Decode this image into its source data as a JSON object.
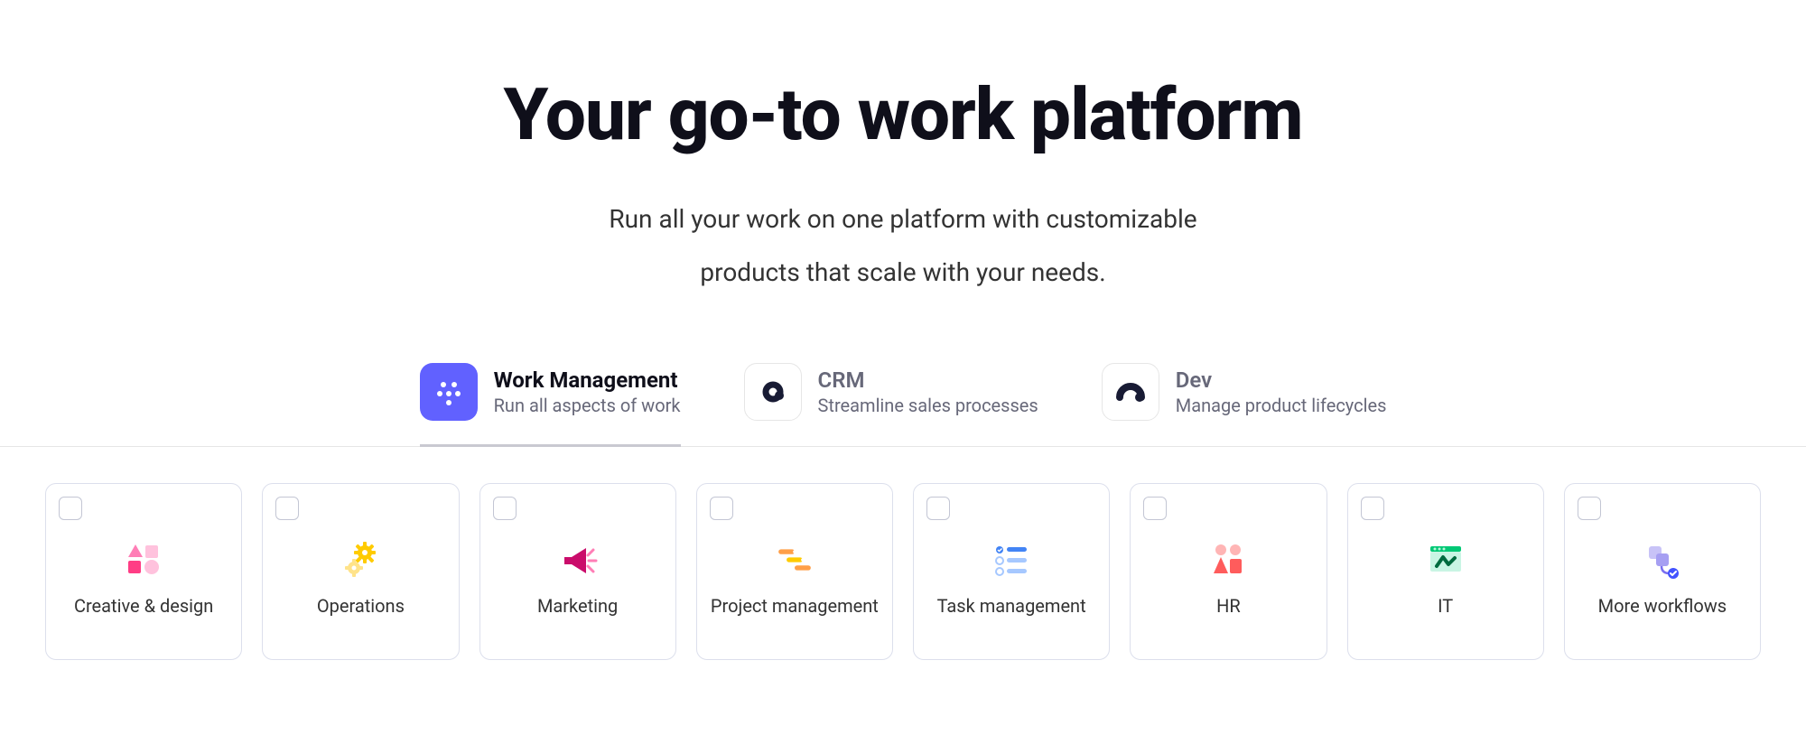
{
  "hero": {
    "title": "Your go-to work platform",
    "subtitle": "Run all your work on one platform with customizable\nproducts that scale with your needs."
  },
  "tabs": [
    {
      "id": "work-management",
      "title": "Work Management",
      "subtitle": "Run all aspects of work",
      "active": true
    },
    {
      "id": "crm",
      "title": "CRM",
      "subtitle": "Streamline sales processes",
      "active": false
    },
    {
      "id": "dev",
      "title": "Dev",
      "subtitle": "Manage product lifecycles",
      "active": false
    }
  ],
  "cards": [
    {
      "id": "creative-design",
      "label": "Creative & design"
    },
    {
      "id": "operations",
      "label": "Operations"
    },
    {
      "id": "marketing",
      "label": "Marketing"
    },
    {
      "id": "project-management",
      "label": "Project management"
    },
    {
      "id": "task-management",
      "label": "Task management"
    },
    {
      "id": "hr",
      "label": "HR"
    },
    {
      "id": "it",
      "label": "IT"
    },
    {
      "id": "more-workflows",
      "label": "More workflows"
    }
  ]
}
